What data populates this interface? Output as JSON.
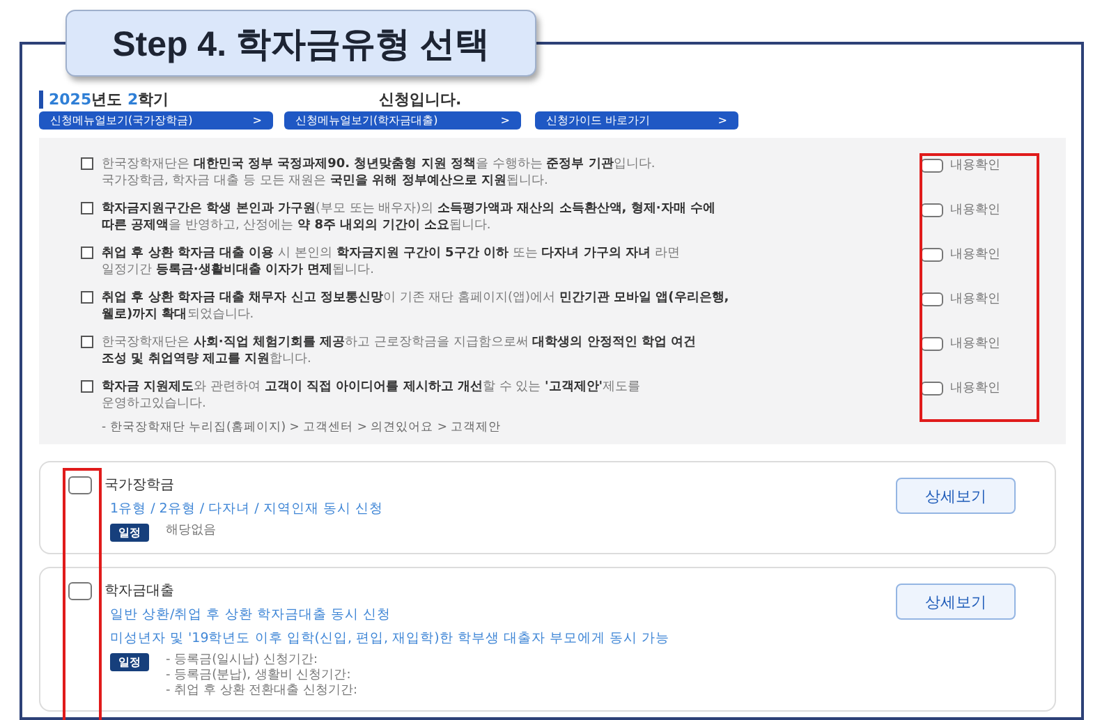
{
  "step_title": "Step 4. 학자금유형 선택",
  "heading": {
    "year": "2025",
    "year_suffix": "년도",
    "term": "2",
    "term_suffix": "학기",
    "notice": "신청입니다."
  },
  "guide_buttons": [
    {
      "label": "신청메뉴얼보기(국가장학금)",
      "arrow": ">"
    },
    {
      "label": "신청메뉴얼보기(학자금대출)",
      "arrow": ">"
    },
    {
      "label": "신청가이드 바로가기",
      "arrow": ">"
    }
  ],
  "notices": [
    {
      "lines": [
        "한국장학재단은 **대한민국 정부 국정과제90. 청년맞춤형 지원 정책**을 수행하는 **준정부 기관**입니다.",
        "국가장학금, 학자금 대출 등 모든 재원은 **국민을 위해 정부예산으로 지원**됩니다."
      ],
      "check_label": "내용확인",
      "checked": false
    },
    {
      "lines": [
        "**학자금지원구간은 학생 본인과 가구원**(부모 또는 배우자)의 **소득평가액과 재산의 소득환산액, 형제·자매 수에**",
        "**따른 공제액**을 반영하고, 산정에는 **약 8주 내외의 기간이 소요**됩니다."
      ],
      "check_label": "내용확인",
      "checked": false
    },
    {
      "lines": [
        "**취업 후 상환 학자금 대출 이용** 시 본인의 **학자금지원 구간이 5구간 이하** 또는 **다자녀 가구의 자녀** 라면",
        "일정기간 **등록금·생활비대출 이자가 면제**됩니다."
      ],
      "check_label": "내용확인",
      "checked": false
    },
    {
      "lines": [
        "**취업 후 상환 학자금 대출 채무자 신고 정보통신망**이 기존 재단 홈페이지(앱)에서 **민간기관 모바일 앱(우리은행,**",
        "**웰로)까지 확대**되었습니다."
      ],
      "check_label": "내용확인",
      "checked": false
    },
    {
      "lines": [
        "한국장학재단은 **사회·직업 체험기회를 제공**하고 근로장학금을 지급함으로써 **대학생의 안정적인 학업 여건**",
        "**조성 및 취업역량 제고를 지원**합니다."
      ],
      "check_label": "내용확인",
      "checked": false
    },
    {
      "lines": [
        "**학자금 지원제도**와 관련하여 **고객이 직접 아이디어를 제시하고 개선**할 수 있는 **'고객제안'**제도를",
        "운영하고있습니다."
      ],
      "sub": "- 한국장학재단 누리집(홈페이지) > 고객센터 > 의견있어요 > 고객제안",
      "check_label": "내용확인",
      "checked": false
    }
  ],
  "types": [
    {
      "title": "국가장학금",
      "checked": false,
      "button": "상세보기",
      "bullets": [
        "1유형 / 2유형 / 다자녀 / 지역인재 동시 신청"
      ],
      "schedule_badge": "일정",
      "schedule": [
        "해당없음"
      ]
    },
    {
      "title": "학자금대출",
      "checked": false,
      "button": "상세보기",
      "bullets": [
        "일반 상환/취업 후 상환 학자금대출 동시 신청",
        "미성년자 및 '19학년도 이후 입학(신입, 편입, 재입학)한 학부생 대출자 부모에게 동시 가능"
      ],
      "schedule_badge": "일정",
      "schedule": [
        "- 등록금(일시납) 신청기간:",
        "- 등록금(분납), 생활비 신청기간:",
        "- 취업 후 상환 전환대출 신청기간:"
      ]
    }
  ]
}
